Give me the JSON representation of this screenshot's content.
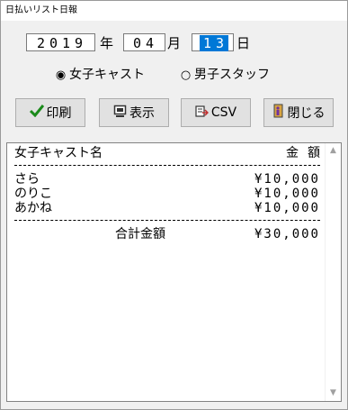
{
  "window": {
    "title": "日払いリスト日報"
  },
  "date": {
    "year": "2019",
    "year_unit": "年",
    "month": "04",
    "month_unit": "月",
    "day": "13",
    "day_unit": "日"
  },
  "filter": {
    "options": [
      {
        "label": "女子キャスト",
        "selected": true
      },
      {
        "label": "男子スタッフ",
        "selected": false
      }
    ]
  },
  "toolbar": {
    "print_label": "印刷",
    "view_label": "表示",
    "csv_label": "CSV",
    "close_label": "閉じる"
  },
  "report": {
    "header": {
      "name_col": "女子キャスト名",
      "amount_col": "金額"
    },
    "rows": [
      {
        "name": "さら",
        "amount": "¥10,000"
      },
      {
        "name": "のりこ",
        "amount": "¥10,000"
      },
      {
        "name": "あかね",
        "amount": "¥10,000"
      }
    ],
    "total": {
      "label": "合計金額",
      "amount": "¥30,000"
    }
  },
  "icons": {
    "print": "checkmark-icon",
    "view": "monitor-icon",
    "csv": "csv-export-icon",
    "close": "exit-door-icon"
  },
  "colors": {
    "selection": "#0078d7",
    "check_green": "#1a8a1a"
  }
}
